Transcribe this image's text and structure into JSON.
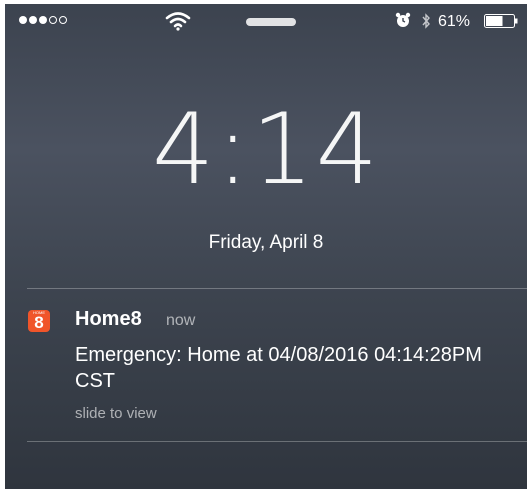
{
  "status_bar": {
    "signal": {
      "filled": 3,
      "total": 5
    },
    "wifi_icon": "wifi-icon",
    "alarm_icon": "alarm-clock-icon",
    "bluetooth_icon": "bluetooth-icon",
    "battery_percent": "61%",
    "battery_level": 0.61
  },
  "lock_screen": {
    "time": "4:14",
    "date": "Friday, April 8"
  },
  "notification": {
    "app_icon_label": "HOME",
    "app_icon_number": "8",
    "app_name": "Home8",
    "time": "now",
    "message": "Emergency: Home at 04/08/2016 04:14:28PM CST",
    "action_hint": "slide to view"
  },
  "colors": {
    "app_icon_bg": "#f0552a",
    "text": "#ffffff"
  }
}
